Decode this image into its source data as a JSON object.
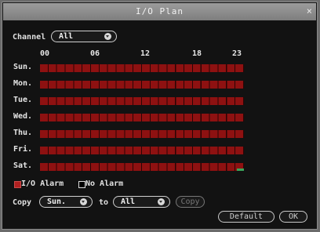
{
  "window": {
    "title": "I/O Plan",
    "close": "×"
  },
  "channel": {
    "label": "Channel",
    "value": "All"
  },
  "hours": [
    "00",
    "06",
    "12",
    "18",
    "23"
  ],
  "days": [
    {
      "label": "Sun."
    },
    {
      "label": "Mon."
    },
    {
      "label": "Tue."
    },
    {
      "label": "Wed."
    },
    {
      "label": "Thu."
    },
    {
      "label": "Fri."
    },
    {
      "label": "Sat."
    }
  ],
  "legend": {
    "io_alarm": "I/O Alarm",
    "io_alarm_color": "#b02020",
    "no_alarm": "No Alarm",
    "no_alarm_color": "#000000"
  },
  "copy": {
    "label": "Copy",
    "from_value": "Sun.",
    "to_label": "to",
    "to_value": "All",
    "button": "Copy"
  },
  "buttons": {
    "default": "Default",
    "ok": "OK"
  }
}
